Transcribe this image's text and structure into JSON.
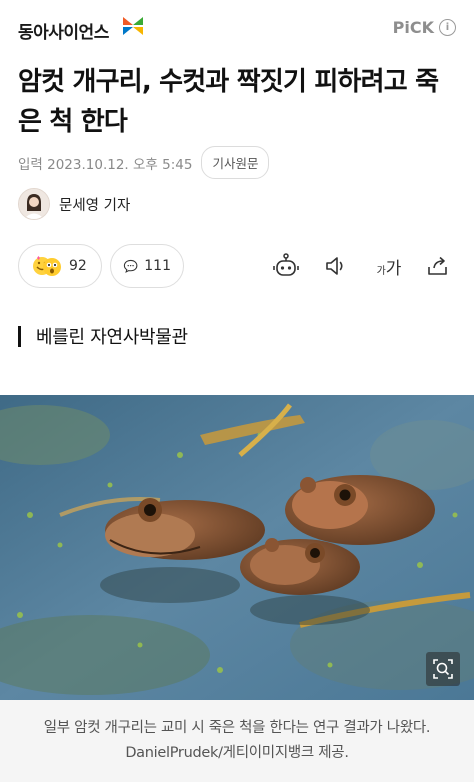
{
  "header": {
    "logo_text": "동아사이언스",
    "pick_label": "PiCK",
    "info_glyph": "i"
  },
  "article": {
    "title": "암컷 개구리, 수컷과 짝짓기 피하려고 죽은 척 한다",
    "date": "입력 2023.10.12. 오후 5:45",
    "source_button": "기사원문",
    "reporter": "문세영 기자",
    "section": "베를린 자연사박물관"
  },
  "actions": {
    "reaction_count": "92",
    "comment_count": "111",
    "font_size_small": "가",
    "font_size_large": "가"
  },
  "photo": {
    "caption": "일부 암컷 개구리는 교미 시 죽은 척을 한다는 연구 결과가 나왔다. DanielPrudek/게티이미지뱅크 제공."
  },
  "colors": {
    "logo_orange": "#f15a24",
    "logo_green": "#3aaa35",
    "logo_blue": "#0078c8",
    "pick_gray": "#8e8e8e"
  }
}
